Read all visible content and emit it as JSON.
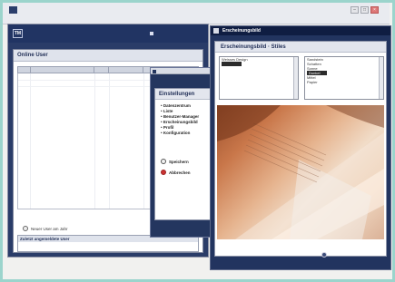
{
  "browser": {
    "title": "",
    "menu": ""
  },
  "main_window": {
    "user_link": "",
    "panel_title": "Online User",
    "new_user_label": "Neuer User am Jahr",
    "online_box": {
      "title": "Zuletzt angemeldete User",
      "lines": []
    }
  },
  "settings_window": {
    "title": "",
    "heading": "Einstellungen",
    "items": [
      "• Datenzentrum",
      "• Liste",
      "• Benutzer-Manager",
      "• Erscheinungsbild",
      "• Profil",
      "• Konfiguration"
    ],
    "option_save": "Speichern",
    "option_cancel": "Abbrechen",
    "warning": "",
    "footer": ""
  },
  "appearance_window": {
    "title": "Erscheinungsbild",
    "heading": "Erscheinungsbild · Stiles",
    "list_left": {
      "label": "Weisses Design",
      "items": []
    },
    "list_right": {
      "items": [
        "Sandstein",
        "Schatten",
        "Sonne",
        "Dunkel",
        "Mittel",
        "Papier"
      ],
      "selected_index": 3
    },
    "hint": "",
    "apply_label": "",
    "brand": ""
  },
  "colors": {
    "navy": "#213463",
    "frame_accent": "#9bd4cc",
    "warning_red": "#c0241a"
  }
}
